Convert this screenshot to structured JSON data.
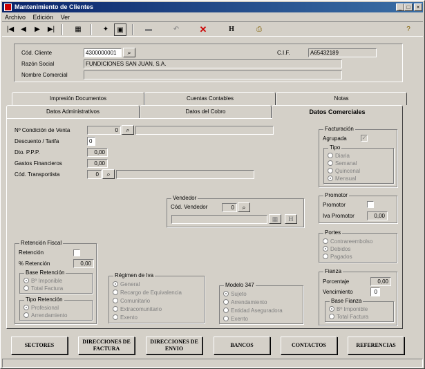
{
  "window": {
    "title": "Mantenimiento de Clientes",
    "min": "_",
    "max": "□",
    "close": "×"
  },
  "menu": [
    "Archivo",
    "Edición",
    "Ver"
  ],
  "toolbar": {
    "h_label": "H"
  },
  "header": {
    "cod_cliente_label": "Cód. Cliente",
    "cod_cliente": "4300000001",
    "cif_label": "C.I.F.",
    "cif": "A65432189",
    "razon_social_label": "Razón Social",
    "razon_social": "FUNDICIONES SAN JUAN, S.A.",
    "nombre_comercial_label": "Nombre Comercial",
    "nombre_comercial": ""
  },
  "tabs": {
    "row1": [
      "Impresión Documentos",
      "Cuentas Contables",
      "Notas"
    ],
    "row2": [
      "Datos Administrativos",
      "Datos del Cobro",
      "Datos Comerciales"
    ]
  },
  "comercial": {
    "condicion_venta_label": "Nº Condición de Venta",
    "condicion_venta": "0",
    "descuento_tarifa_label": "Descuento / Tarifa",
    "descuento_tarifa": "0",
    "dto_ppp_label": "Dto. P.P.P.",
    "dto_ppp": "0,00",
    "gastos_financieros_label": "Gastos Financieros",
    "gastos_financieros": "0,00",
    "transportista_label": "Cód. Transportista",
    "transportista": "0"
  },
  "vendedor": {
    "title": "Vendedor",
    "cod_label": "Cód. Vendedor",
    "cod": "0",
    "h_label": "H"
  },
  "facturacion": {
    "title": "Facturación",
    "agrupada_label": "Agrupada",
    "agrupada_check": "✓",
    "tipo_title": "Tipo",
    "tipos": [
      "Diaria",
      "Semanal",
      "Quincenal",
      "Mensual"
    ]
  },
  "promotor": {
    "title": "Promotor",
    "promotor_label": "Promotor",
    "iva_label": "Iva Promotor",
    "iva": "0,00"
  },
  "portes": {
    "title": "Portes",
    "options": [
      "Contrareembolso",
      "Debidos",
      "Pagados"
    ]
  },
  "fianza": {
    "title": "Fianza",
    "porcentaje_label": "Porcentaje",
    "porcentaje": "0,00",
    "vencimiento_label": "Vencimiento",
    "vencimiento": "0",
    "base_title": "Base Fianza",
    "base_options": [
      "Bº Imponible",
      "Total Factura"
    ]
  },
  "retencion": {
    "title": "Retención Fiscal",
    "retencion_label": "Retención",
    "pct_label": "% Retención",
    "pct": "0,00",
    "base_title": "Base Retención",
    "base_options": [
      "Bº Imponible",
      "Total Factura"
    ],
    "tipo_title": "Tipo Retención",
    "tipo_options": [
      "Profesional",
      "Arrendamiento"
    ]
  },
  "regimen_iva": {
    "title": "Régimen de Iva",
    "options": [
      "General",
      "Recargo de Equivalencia",
      "Comunitario",
      "Extracomunitario",
      "Exento"
    ]
  },
  "modelo347": {
    "title": "Modelo 347",
    "options": [
      "Sujeto",
      "Arrendamiento",
      "Entidad Aseguradora",
      "Exento"
    ]
  },
  "buttons": {
    "sectores": "SECTORES",
    "dir_factura": "DIRECCIONES DE FACTURA",
    "dir_envio": "DIRECCIONES DE ENVIO",
    "bancos": "BANCOS",
    "contactos": "CONTACTOS",
    "referencias": "REFERENCIAS"
  }
}
